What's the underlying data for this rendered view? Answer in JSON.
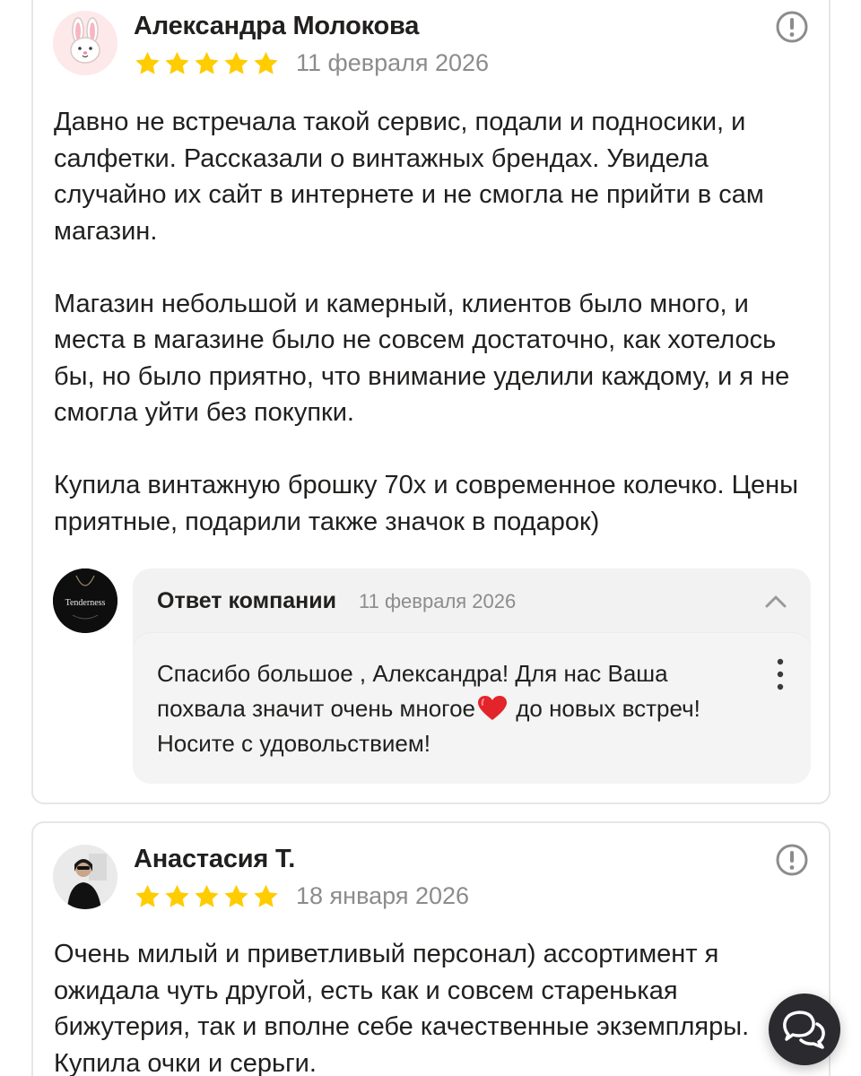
{
  "reviews": [
    {
      "author": "Александра Молокова",
      "avatar_icon": "rabbit-face-icon",
      "rating": 5,
      "date": "11 февраля 2026",
      "paragraphs": [
        "Давно не встречала такой сервис, подали и подносики, и салфетки. Рассказали о винтажных брендах. Увидела случайно их сайт в интернете и не смогла не прийти в сам магазин.",
        "Магазин небольшой и камерный, клиентов было много, и места в магазине было не совсем достаточно, как хотелось бы, но было приятно, что внимание уделили каждому, и я не смогла уйти без покупки.",
        "Купила винтажную брошку 70х и современное колечко. Цены приятные, подарили также значок в подарок)"
      ],
      "company_reply": {
        "title": "Ответ компании",
        "date": "11 февраля 2026",
        "avatar_text": "Tenderness",
        "text_before_emoji": "Спасибо большое , Александра! Для нас Ваша похвала значит очень многое",
        "emoji": "red-heart-icon",
        "text_after_emoji": " до новых встреч! Носите с удовольствием!"
      }
    },
    {
      "author": "Анастасия Т.",
      "avatar_icon": "user-photo-avatar",
      "rating": 5,
      "date": "18 января 2026",
      "paragraphs": [
        "Очень милый и приветливый персонал) ассортимент я ожидала чуть другой, есть как и совсем старенькая бижутерия, так и вполне себе качественные экземпляры. Купила очки и серьги."
      ]
    }
  ],
  "icons": {
    "star": "star-icon",
    "report": "exclamation-circle-icon",
    "collapse": "chevron-up-icon",
    "more": "more-vertical-icon",
    "chat": "chat-bubbles-icon"
  },
  "colors": {
    "star": "#fc0",
    "text": "#21201f",
    "muted": "#8c8c8c",
    "reply_bg": "#f2f2f2",
    "card_border": "#e6e6e6",
    "fab": "#2b2b2f"
  }
}
